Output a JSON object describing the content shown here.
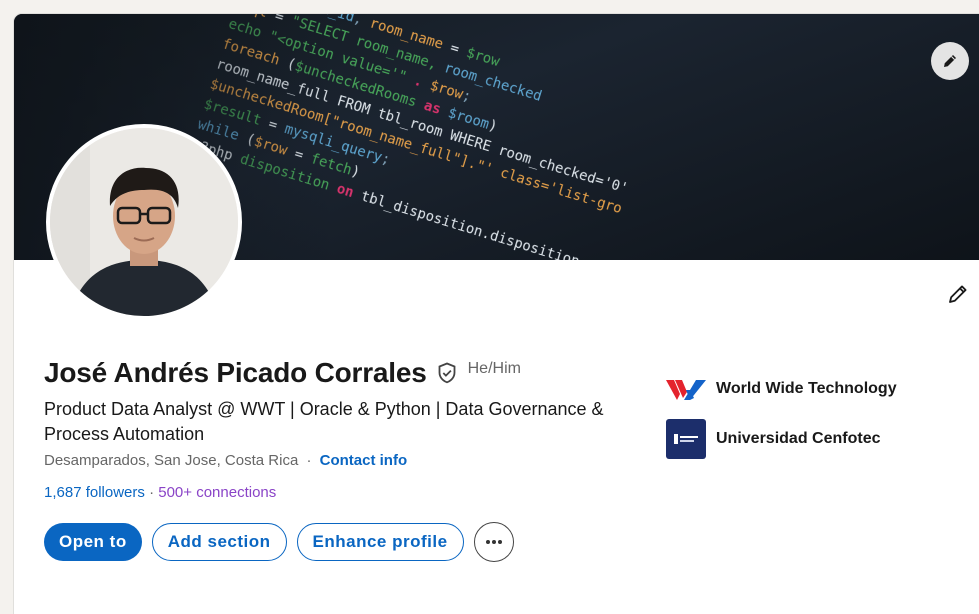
{
  "profile": {
    "name": "José Andrés Picado Corrales",
    "pronouns": "He/Him",
    "headline": "Product Data Analyst @ WWT | Oracle & Python | Data Governance & Process Automation",
    "location": "Desamparados, San Jose, Costa Rica",
    "location_sep": "·",
    "contact_info": "Contact info",
    "followers": "1,687 followers",
    "network_sep": "·",
    "connections": "500+ connections"
  },
  "actions": {
    "open_to": "Open to",
    "add_section": "Add section",
    "enhance_profile": "Enhance profile"
  },
  "organizations": [
    {
      "name": "World Wide Technology",
      "logo_icon": "wwt-logo-icon"
    },
    {
      "name": "Universidad Cenfotec",
      "logo_icon": "cenfotec-logo-icon"
    }
  ],
  "banner_code": {
    "line1": "room_name_full FROM tbl_room WHERE room_checked='0'",
    "line2": "$uncheckedRoom[\"room_name_full\"].\"' class='list-gro",
    "line3": "tbl_disposition.disposition_user"
  },
  "colors": {
    "primary": "#0a66c2",
    "connections": "#8a44c7",
    "text": "#191919",
    "muted": "#666666"
  }
}
